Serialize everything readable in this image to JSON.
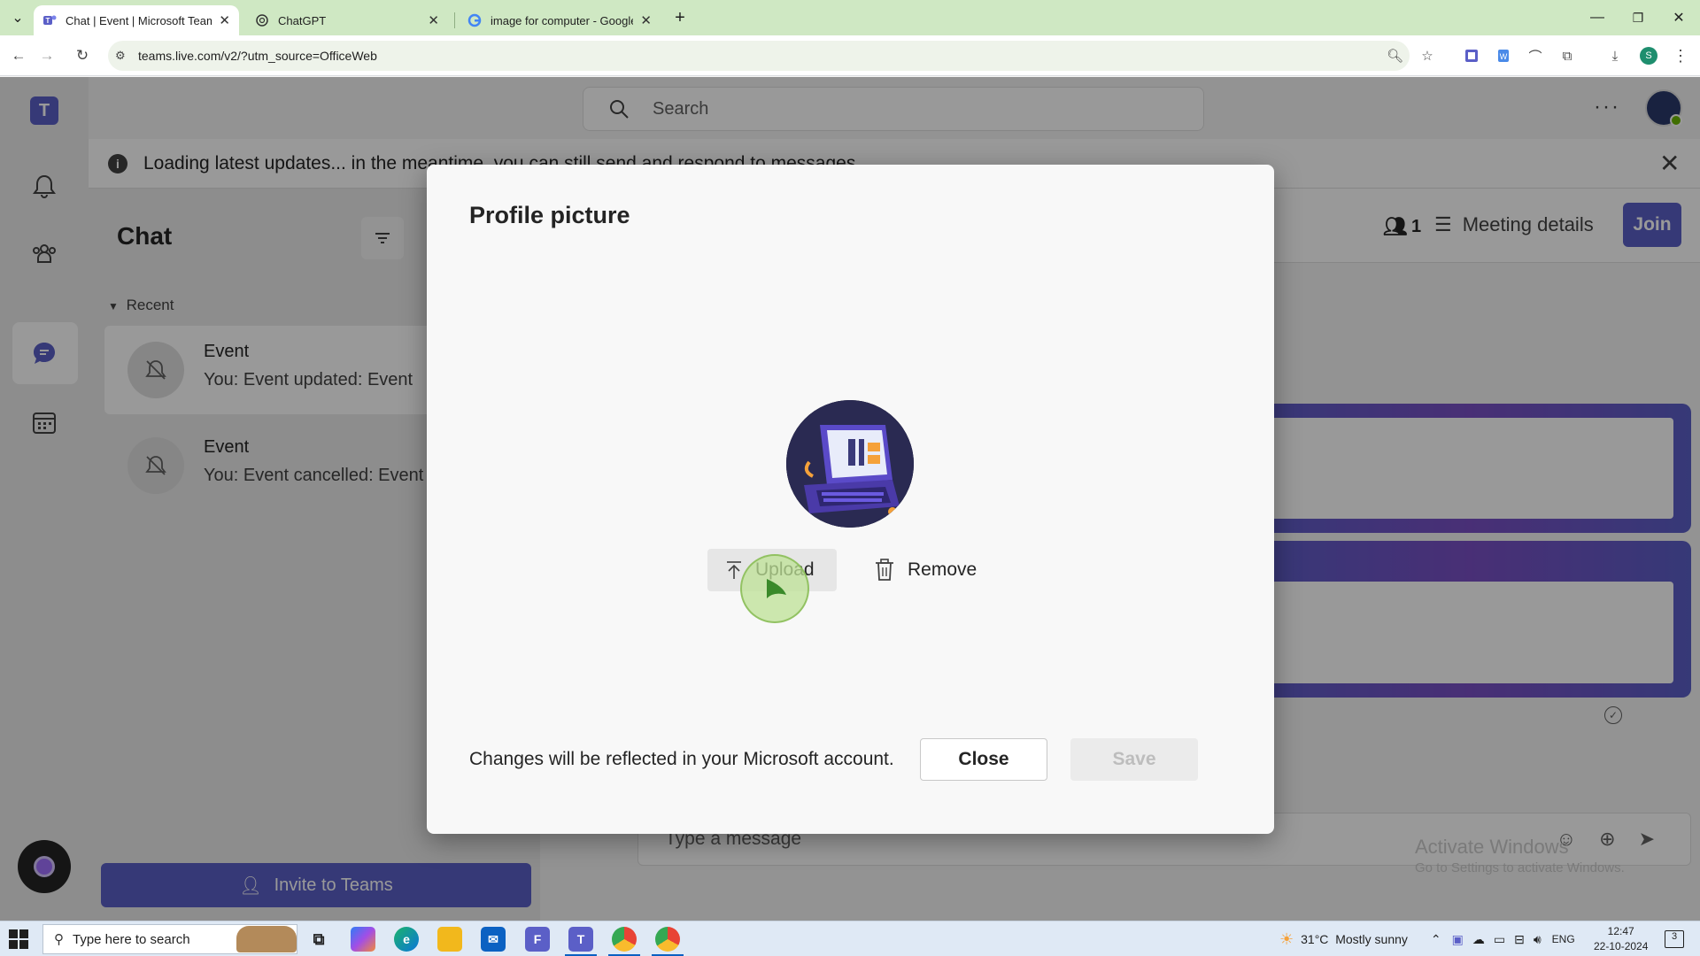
{
  "browser": {
    "tabs": [
      {
        "title": "Chat | Event | Microsoft Teams",
        "icon": "teams-icon"
      },
      {
        "title": "ChatGPT",
        "icon": "chatgpt-icon"
      },
      {
        "title": "image for computer - Google S",
        "icon": "google-icon"
      }
    ],
    "url": "teams.live.com/v2/?utm_source=OfficeWeb",
    "profile_initial": "S"
  },
  "teams": {
    "search_placeholder": "Search",
    "banner_text": "Loading latest updates... in the meantime, you can still send and respond to messages.",
    "chat_title": "Chat",
    "recent_label": "Recent",
    "chats": [
      {
        "name": "Event",
        "preview": "You: Event updated: Event"
      },
      {
        "name": "Event",
        "preview": "You: Event cancelled: Event"
      }
    ],
    "invite_label": "Invite to Teams",
    "participant_count": "1",
    "meeting_details_label": "Meeting details",
    "join_label": "Join",
    "composer_placeholder": "Type a message"
  },
  "dialog": {
    "title": "Profile picture",
    "upload_label": "Upload",
    "remove_label": "Remove",
    "note": "Changes will be reflected in your Microsoft account.",
    "close_label": "Close",
    "save_label": "Save"
  },
  "watermark": {
    "line1": "Activate Windows",
    "line2": "Go to Settings to activate Windows."
  },
  "taskbar": {
    "search_placeholder": "Type here to search",
    "weather": "31°C  Mostly sunny",
    "language": "ENG",
    "time": "12:47",
    "date": "22-10-2024",
    "notification_count": "3"
  },
  "colors": {
    "teams_purple": "#5b5fc7",
    "tab_strip": "#cfe8c3",
    "save_disabled_text": "#bdbdbd"
  }
}
